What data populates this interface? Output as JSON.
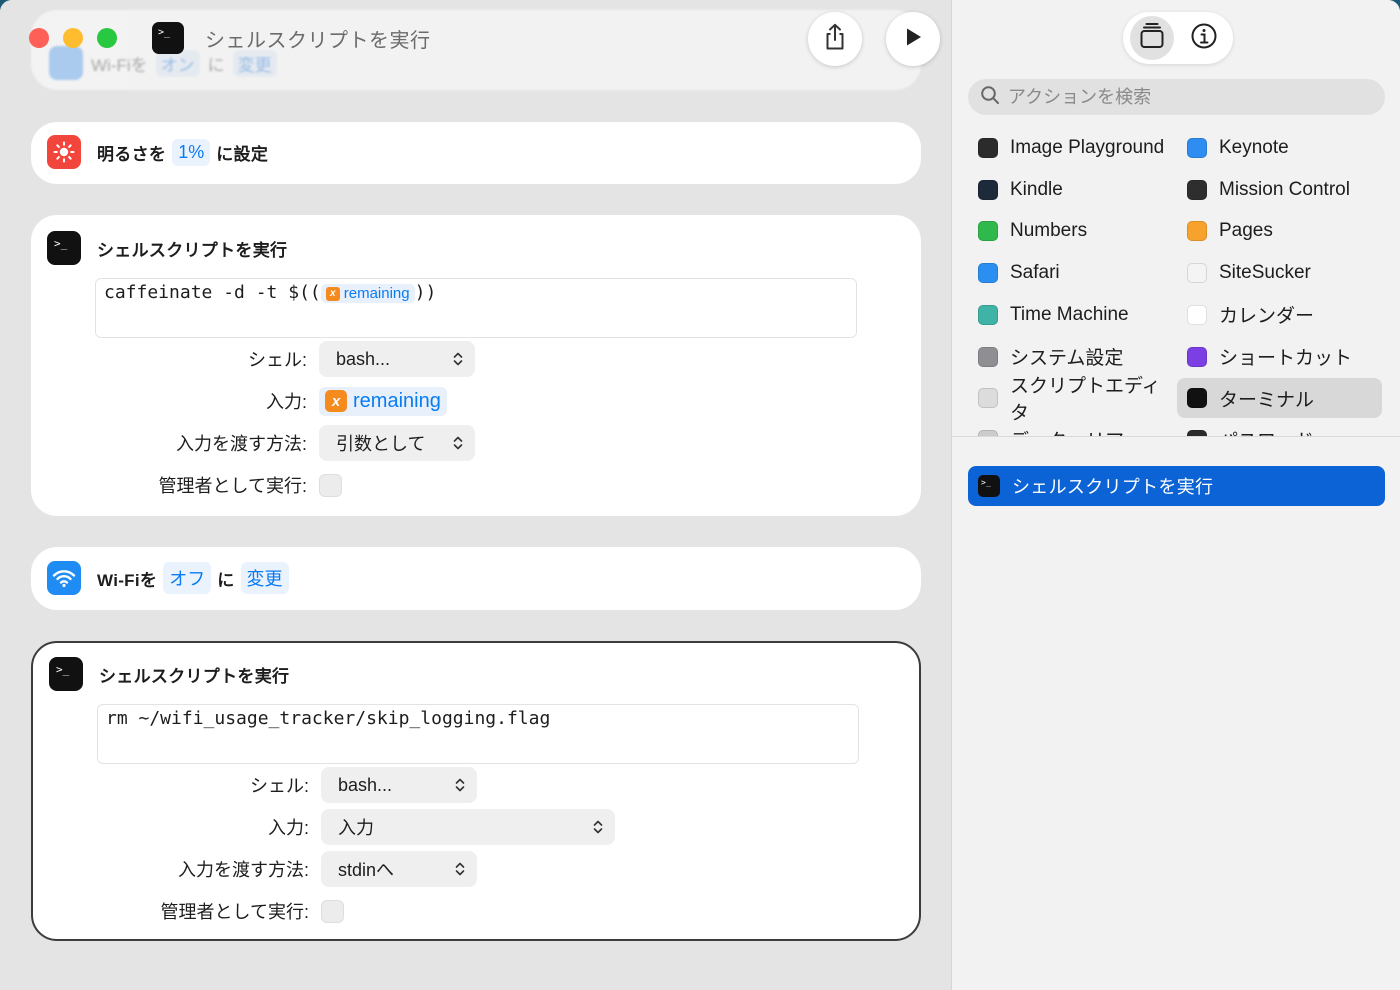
{
  "window": {
    "title": "シェルスクリプトを実行",
    "share_icon": "share-icon",
    "run_icon": "play-icon"
  },
  "partial_top_card": {
    "text": "Wi-Fiを",
    "state_token": "オン",
    "mid": "に",
    "action_token": "変更"
  },
  "brightness_card": {
    "prefix": "明るさを",
    "value": "1%",
    "suffix": "に設定"
  },
  "shell_card_1": {
    "title": "シェルスクリプトを実行",
    "script_prefix": "caffeinate -d -t $((",
    "script_var": "remaining",
    "script_suffix": "))",
    "shell_label": "シェル:",
    "shell_value": "bash...",
    "input_label": "入力:",
    "input_var": "remaining",
    "pass_label": "入力を渡す方法:",
    "pass_value": "引数として",
    "admin_label": "管理者として実行:"
  },
  "wifi_card": {
    "text": "Wi-Fiを",
    "state_token": "オフ",
    "mid": "に",
    "action_token": "変更"
  },
  "shell_card_2": {
    "title": "シェルスクリプトを実行",
    "script": "rm ~/wifi_usage_tracker/skip_logging.flag",
    "shell_label": "シェル:",
    "shell_value": "bash...",
    "input_label": "入力:",
    "input_value": "入力",
    "pass_label": "入力を渡す方法:",
    "pass_value": "stdinへ",
    "admin_label": "管理者として実行:"
  },
  "sidebar": {
    "search_placeholder": "アクションを検索",
    "apps": [
      {
        "label": "Image Playground",
        "icon": "image-playground-icon",
        "color": "#2b2b2b"
      },
      {
        "label": "Keynote",
        "icon": "keynote-icon",
        "color": "#2f8cf0"
      },
      {
        "label": "Kindle",
        "icon": "kindle-icon",
        "color": "#1c2a3a"
      },
      {
        "label": "Mission Control",
        "icon": "mission-control-icon",
        "color": "#2e2e2e"
      },
      {
        "label": "Numbers",
        "icon": "numbers-icon",
        "color": "#2fb84b"
      },
      {
        "label": "Pages",
        "icon": "pages-icon",
        "color": "#f7a22d"
      },
      {
        "label": "Safari",
        "icon": "safari-icon",
        "color": "#2a8ff0"
      },
      {
        "label": "SiteSucker",
        "icon": "sitesucker-icon",
        "color": "#f4f4f4"
      },
      {
        "label": "Time Machine",
        "icon": "time-machine-icon",
        "color": "#3fb3a5"
      },
      {
        "label": "カレンダー",
        "icon": "calendar-icon",
        "color": "#ffffff"
      },
      {
        "label": "システム設定",
        "icon": "system-settings-icon",
        "color": "#8e8e93"
      },
      {
        "label": "ショートカット",
        "icon": "shortcuts-icon",
        "color": "#7b3fe4"
      },
      {
        "label": "スクリプトエディタ",
        "icon": "script-editor-icon",
        "color": "#dcdcdc"
      },
      {
        "label": "ターミナル",
        "icon": "terminal-icon",
        "color": "#111111"
      },
      {
        "label": "データ…リア",
        "icon": "partial-app-icon",
        "color": "#cccccc"
      },
      {
        "label": "パスワード",
        "icon": "passwords-icon",
        "color": "#2b2b2b"
      }
    ],
    "selected_app": "ターミナル",
    "actions": [
      {
        "label": "シェルスクリプトを実行",
        "icon": "terminal-icon"
      }
    ]
  },
  "colors": {
    "accent": "#0b63d6",
    "token_blue": "#0a7cf2",
    "variable_orange": "#f58a1f",
    "close": "#fe5f57",
    "minimize": "#febc2e",
    "zoom": "#28c840"
  }
}
